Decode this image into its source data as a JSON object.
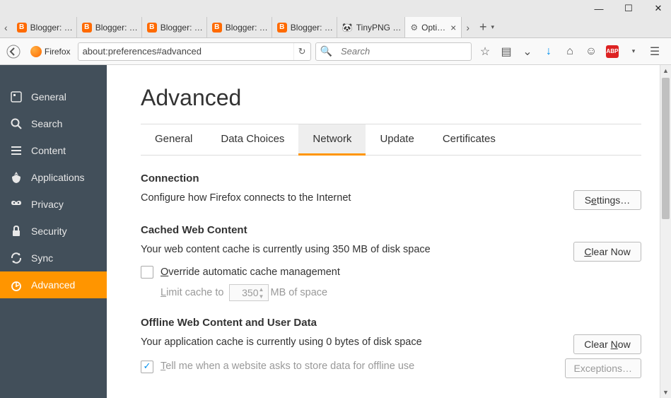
{
  "window_buttons": {
    "min": "—",
    "max": "☐",
    "close": "✕"
  },
  "tabs": [
    {
      "favicon": "blogger",
      "label": "Blogger: …"
    },
    {
      "favicon": "blogger",
      "label": "Blogger: …"
    },
    {
      "favicon": "blogger",
      "label": "Blogger: …"
    },
    {
      "favicon": "blogger",
      "label": "Blogger: …"
    },
    {
      "favicon": "blogger",
      "label": "Blogger: …"
    },
    {
      "favicon": "panda",
      "label": "TinyPNG …"
    },
    {
      "favicon": "gear",
      "label": "Opti…",
      "active": true
    }
  ],
  "url": {
    "identity": "Firefox",
    "value": "about:preferences#advanced"
  },
  "search": {
    "placeholder": "Search"
  },
  "sidebar": {
    "items": [
      {
        "icon": "general",
        "label": "General"
      },
      {
        "icon": "search",
        "label": "Search"
      },
      {
        "icon": "content",
        "label": "Content"
      },
      {
        "icon": "applications",
        "label": "Applications"
      },
      {
        "icon": "privacy",
        "label": "Privacy"
      },
      {
        "icon": "security",
        "label": "Security"
      },
      {
        "icon": "sync",
        "label": "Sync"
      },
      {
        "icon": "advanced",
        "label": "Advanced",
        "active": true
      }
    ]
  },
  "page": {
    "title": "Advanced",
    "tabs": [
      {
        "label": "General"
      },
      {
        "label": "Data Choices"
      },
      {
        "label": "Network",
        "active": true
      },
      {
        "label": "Update"
      },
      {
        "label": "Certificates"
      }
    ],
    "connection": {
      "head": "Connection",
      "desc": "Configure how Firefox connects to the Internet",
      "button_pre": "S",
      "button_u": "e",
      "button_post": "ttings…"
    },
    "cache": {
      "head": "Cached Web Content",
      "desc": "Your web content cache is currently using 350 MB of disk space",
      "clear_u": "C",
      "clear_post": "lear Now",
      "override_u": "O",
      "override_post": "verride automatic cache management",
      "limit_u": "L",
      "limit_post": "imit cache to",
      "limit_value": "350",
      "limit_suffix": "MB of space"
    },
    "offline": {
      "head": "Offline Web Content and User Data",
      "desc": "Your application cache is currently using 0 bytes of disk space",
      "clear_pre": "Clear ",
      "clear_u": "N",
      "clear_post": "ow",
      "exceptions": "Exceptions…",
      "tell_u": "T",
      "tell_post": "ell me when a website asks to store data for offline use"
    }
  }
}
